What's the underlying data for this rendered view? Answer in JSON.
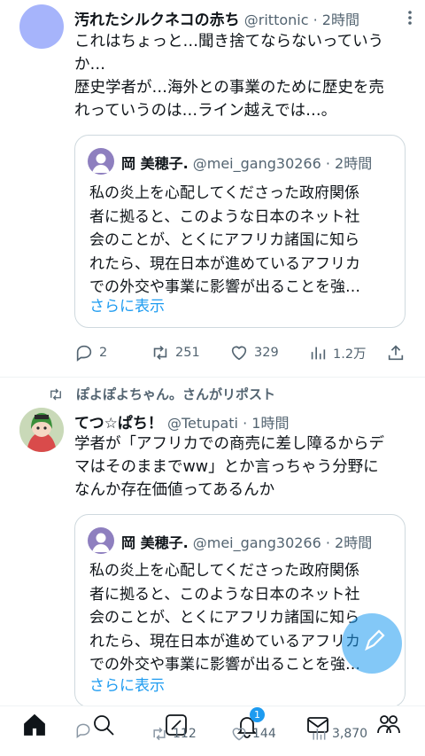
{
  "tweet1": {
    "name": "汚れたシルクネコの赤ち",
    "handle": "@rittonic",
    "time": "· 2時間",
    "more_icon": "more-vertical-icon",
    "body": [
      "これはちょっと…聞き捨てならないっていう",
      "か…",
      "歴史学者が…海外との事業のために歴史を売",
      "れっていうのは…ライン越えでは…。"
    ],
    "quote": {
      "name": "岡 美穂子.",
      "handle": "@mei_gang30266",
      "time": "· 2時間",
      "body": [
        "私の炎上を心配してくださった政府関係",
        "者に拠ると、このような日本のネット社",
        "会のことが、とくにアフリカ諸国に知ら",
        "れたら、現在日本が進めているアフリカ",
        "での外交や事業に影響が出ることを強…"
      ],
      "more": "さらに表示"
    },
    "actions": {
      "replies": "2",
      "reposts": "251",
      "likes": "329",
      "views": "1.2万"
    }
  },
  "retweet_label": "ぽよぽよちゃん。さんがリポスト",
  "tweet2": {
    "name": "てつ☆ぱち！",
    "handle": "@Tetupati",
    "time": "· 1時間",
    "body": [
      "学者が「アフリカでの商売に差し障るからデ",
      "マはそのままでww」とか言っちゃう分野に",
      "なんか存在価値ってあるんか"
    ],
    "quote": {
      "name": "岡 美穂子.",
      "handle": "@mei_gang30266",
      "time": "· 2時間",
      "body": [
        "私の炎上を心配してくださった政府関係",
        "者に拠ると、このような日本のネット社",
        "会のことが、とくにアフリカ諸国に知ら",
        "れたら、現在日本が進めているアフリカ",
        "での外交や事業に影響が出ることを強…"
      ],
      "more": "さらに表示"
    },
    "actions": {
      "reposts": "112",
      "likes": "144",
      "views": "3,870"
    }
  },
  "navbar": {
    "notification_count": "1"
  },
  "colors": {
    "accent": "#1d9bf0",
    "text": "#0f1419",
    "secondary": "#536471"
  }
}
